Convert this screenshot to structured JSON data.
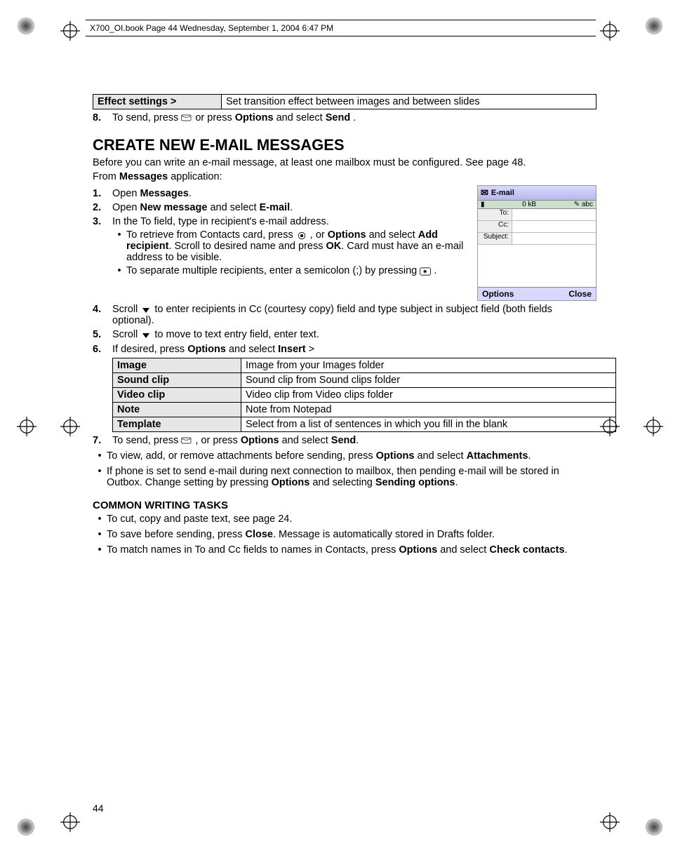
{
  "header_stamp": "X700_OI.book  Page 44  Wednesday, September 1, 2004  6:47 PM",
  "page_number": "44",
  "effect_row": {
    "label": "Effect settings >",
    "desc": "Set transition effect between images and between slides"
  },
  "step8": {
    "num": "8.",
    "pre": "To send, press ",
    "mid": " or press ",
    "opt": "Options",
    "and": " and select ",
    "send": "Send",
    "end": "."
  },
  "section_title": "CREATE NEW E-MAIL MESSAGES",
  "intro": "Before you can write an e-mail message, at least one mailbox must be configured. See page 48.",
  "from_line_pre": "From ",
  "from_line_bold": "Messages",
  "from_line_post": " application:",
  "steps": {
    "s1": {
      "num": "1.",
      "pre": "Open ",
      "b": "Messages",
      "post": "."
    },
    "s2": {
      "num": "2.",
      "pre": "Open ",
      "b1": "New message",
      "mid": " and select ",
      "b2": "E-mail",
      "post": "."
    },
    "s3": {
      "num": "3.",
      "text": "In the To field, type in recipient's e-mail address."
    },
    "s3a": {
      "pre": "To retrieve from Contacts card, press ",
      "mid1": ", or ",
      "b1": "Options",
      "mid2": " and select ",
      "b2": "Add recipient",
      "mid3": ". Scroll to desired name and press ",
      "b3": "OK",
      "post": ". Card must have an e-mail address to be visible."
    },
    "s3b": {
      "pre": "To separate multiple recipients, enter a semicolon (;) by pressing ",
      "post": "."
    },
    "s4": {
      "num": "4.",
      "pre": "Scroll ",
      "post": " to enter recipients in Cc (courtesy copy) field and type subject in subject field (both fields optional)."
    },
    "s5": {
      "num": "5.",
      "pre": "Scroll ",
      "post": " to move to text entry field, enter text."
    },
    "s6": {
      "num": "6.",
      "pre": "If desired, press ",
      "b1": "Options",
      "mid": " and select ",
      "b2": "Insert",
      "post": " >"
    },
    "s7": {
      "num": "7.",
      "pre": " To send, press ",
      "mid": ", or press ",
      "b1": "Options",
      "and": " and select ",
      "b2": "Send",
      "post": "."
    }
  },
  "insert_table": [
    {
      "k": "Image",
      "v": "Image from your Images folder"
    },
    {
      "k": "Sound clip",
      "v": "Sound clip from Sound clips folder"
    },
    {
      "k": "Video clip",
      "v": "Video clip from Video clips folder"
    },
    {
      "k": "Note",
      "v": "Note from Notepad"
    },
    {
      "k": "Template",
      "v": "Select from a list of sentences in which you fill in the blank"
    }
  ],
  "after_bullets": {
    "b1": {
      "pre": "To view, add, or remove attachments before sending, press ",
      "b1": "Options",
      "mid": " and select ",
      "b2": "Attachments",
      "post": "."
    },
    "b2": {
      "pre": "If phone is set to send e-mail during next connection to mailbox, then pending e-mail will be stored in Outbox. Change setting by pressing ",
      "b1": "Options",
      "mid": " and selecting ",
      "b2": "Sending options",
      "post": "."
    }
  },
  "common_heading": "COMMON WRITING TASKS",
  "common": {
    "c1": "To cut, copy and paste text, see page 24.",
    "c2": {
      "pre": "To save before sending, press ",
      "b": "Close",
      "post": ". Message is automatically stored in Drafts folder."
    },
    "c3": {
      "pre": "To match names in To and Cc fields to names in Contacts, press ",
      "b1": "Options",
      "mid": " and select ",
      "b2": "Check contacts",
      "post": "."
    }
  },
  "phone": {
    "title": "E-mail",
    "status_left": "0 kB",
    "status_right": "abc",
    "to": "To:",
    "cc": "Cc:",
    "subject": "Subject:",
    "left": "Options",
    "right": "Close"
  }
}
